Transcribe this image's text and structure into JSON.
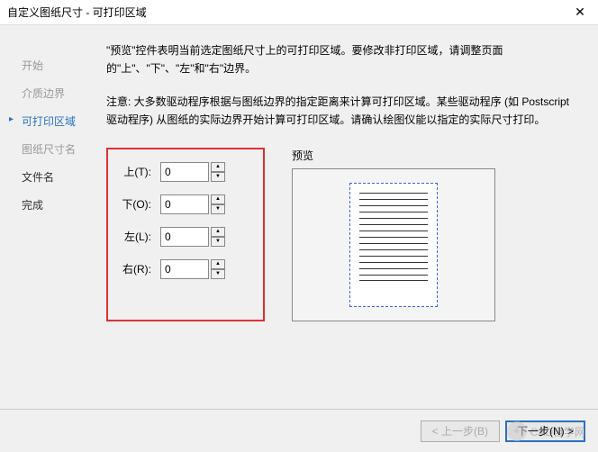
{
  "titlebar": {
    "title": "自定义图纸尺寸 - 可打印区域",
    "close": "✕"
  },
  "sidebar": {
    "items": [
      {
        "label": "开始"
      },
      {
        "label": "介质边界"
      },
      {
        "label": "可打印区域"
      },
      {
        "label": "图纸尺寸名"
      },
      {
        "label": "文件名"
      },
      {
        "label": "完成"
      }
    ]
  },
  "main": {
    "desc1": "\"预览\"控件表明当前选定图纸尺寸上的可打印区域。要修改非打印区域，请调整页面的\"上\"、\"下\"、\"左\"和\"右\"边界。",
    "desc2": "注意: 大多数驱动程序根据与图纸边界的指定距离来计算可打印区域。某些驱动程序 (如 Postscript 驱动程序) 从图纸的实际边界开始计算可打印区域。请确认绘图仪能以指定的实际尺寸打印。",
    "margins": {
      "top": {
        "label": "上(T):",
        "value": "0"
      },
      "bottom": {
        "label": "下(O):",
        "value": "0"
      },
      "left": {
        "label": "左(L):",
        "value": "0"
      },
      "right": {
        "label": "右(R):",
        "value": "0"
      }
    },
    "preview_label": "预览"
  },
  "footer": {
    "back": "< 上一步(B)",
    "next": "下一步(N) >",
    "cancel_hidden": ""
  },
  "watermark": {
    "text": "CAD自学网"
  }
}
